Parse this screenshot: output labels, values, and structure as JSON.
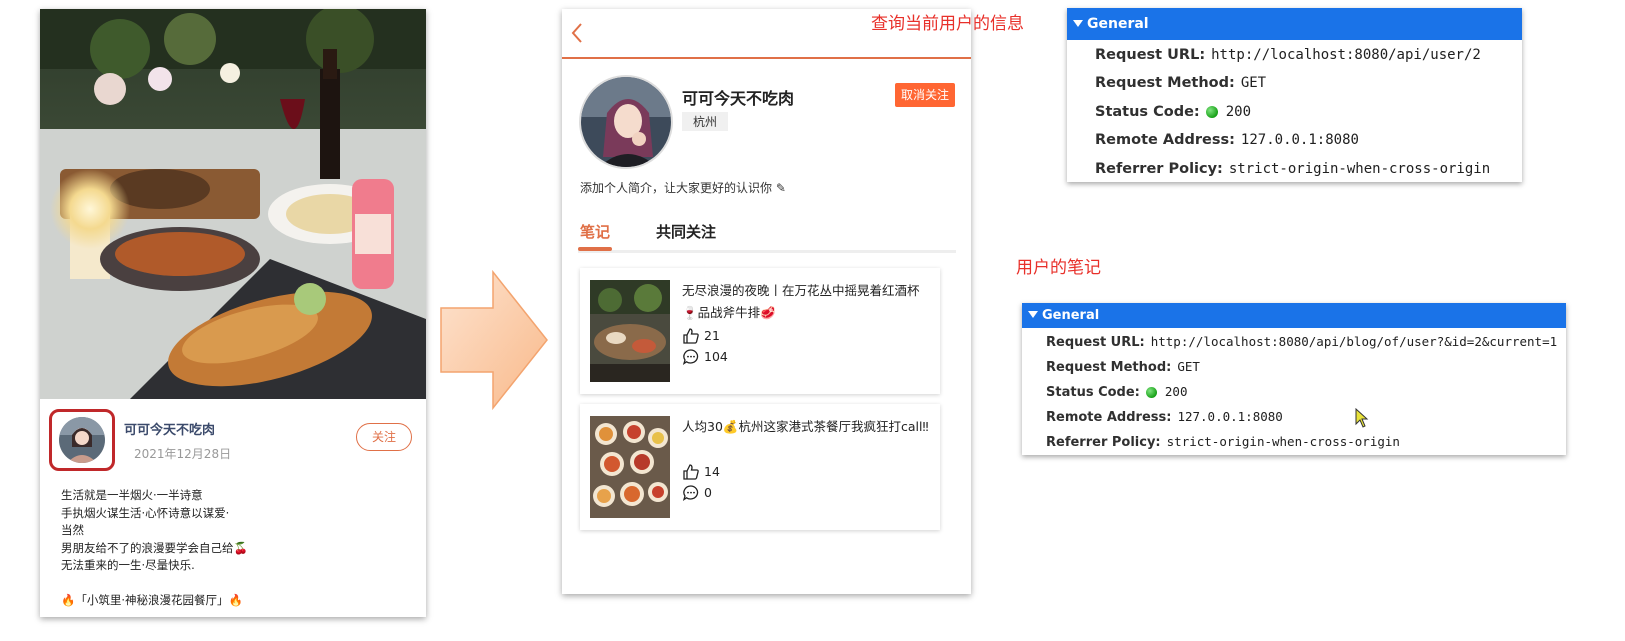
{
  "blog_detail": {
    "author": {
      "name": "可可今天不吃肉",
      "date": "2021年12月28日",
      "follow_label": "关注"
    },
    "content_lines": [
      "生活就是一半烟火·一半诗意",
      "手执烟火谋生活·心怀诗意以谋爱·",
      "当然",
      "男朋友给不了的浪漫要学会自己给🍒",
      "无法重来的一生·尽量快乐.",
      "",
      "🔥「小筑里·神秘浪漫花园餐厅」🔥"
    ]
  },
  "profile": {
    "name": "可可今天不吃肉",
    "city": "杭州",
    "unfollow_label": "取消关注",
    "intro": "添加个人简介，让大家更好的认识你 ✎",
    "tabs": [
      {
        "label": "笔记",
        "active": true
      },
      {
        "label": "共同关注",
        "active": false
      }
    ],
    "notes": [
      {
        "title": "无尽浪漫的夜晚丨在万花丛中摇晃着红酒杯🍷品战斧牛排🥩",
        "likes": "21",
        "comments": "104",
        "like_icon": "thumbs-up-icon",
        "comment_icon": "comment-icon"
      },
      {
        "title": "人均30💰杭州这家港式茶餐厅我疯狂打call‼",
        "likes": "14",
        "comments": "0",
        "like_icon": "thumbs-up-icon",
        "comment_icon": "comment-icon"
      }
    ]
  },
  "captions": {
    "user_info": "查询当前用户的信息",
    "user_notes": "用户的笔记"
  },
  "panel_user": {
    "title": "General",
    "rows": {
      "url_key": "Request URL:",
      "url_val": "http://localhost:8080/api/user/2",
      "method_key": "Request Method:",
      "method_val": "GET",
      "status_key": "Status Code:",
      "status_val": "200",
      "remote_key": "Remote Address:",
      "remote_val": "127.0.0.1:8080",
      "policy_key": "Referrer Policy:",
      "policy_val": "strict-origin-when-cross-origin"
    }
  },
  "panel_blog": {
    "title": "General",
    "rows": {
      "url_key": "Request URL:",
      "url_val": "http://localhost:8080/api/blog/of/user?&id=2&current=1",
      "method_key": "Request Method:",
      "method_val": "GET",
      "status_key": "Status Code:",
      "status_val": "200",
      "remote_key": "Remote Address:",
      "remote_val": "127.0.0.1:8080",
      "policy_key": "Referrer Policy:",
      "policy_val": "strict-origin-when-cross-origin"
    }
  },
  "colors": {
    "accent": "#e07047",
    "unfollow_bg": "#ff6633",
    "caption_red": "#e8302a",
    "panel_header": "#1a73e8",
    "status_green": "#17a117"
  }
}
